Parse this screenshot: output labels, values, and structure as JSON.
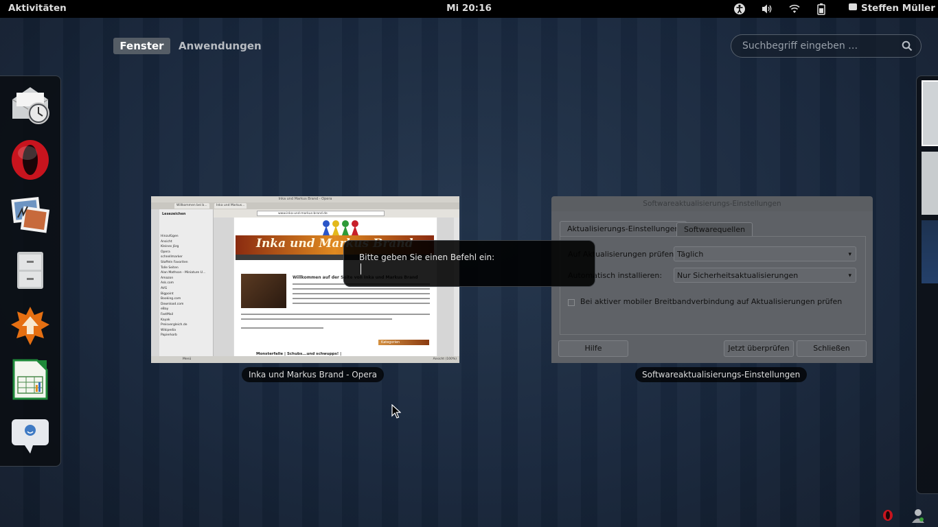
{
  "panel": {
    "activities": "Aktivitäten",
    "clock": "Mi 20:16",
    "user": "Steffen Müller",
    "icons": [
      "accessibility-icon",
      "volume-icon",
      "wifi-icon",
      "battery-icon",
      "chat-icon"
    ]
  },
  "view_selector": {
    "windows": "Fenster",
    "applications": "Anwendungen"
  },
  "search": {
    "placeholder": "Suchbegriff eingeben …"
  },
  "dash": {
    "items": [
      "evolution-mail-icon",
      "opera-icon",
      "shotwell-icon",
      "file-cabinet-icon",
      "update-manager-icon",
      "libreoffice-calc-icon",
      "empathy-chat-icon"
    ]
  },
  "windows": {
    "opera": {
      "caption": "Inka und Markus Brand - Opera",
      "title": "Inka und Markus Brand - Opera",
      "tab1": "Willkommen bei b...",
      "tab2": "Inka und Markus...",
      "address": "www.inka-und-markus-brand.de",
      "sidebar_title": "Lesezeichen",
      "bookmarks": [
        "Hinzufügen",
        "Ansicht",
        "Kleines Jörg",
        "Opera",
        "schnellmarker",
        "Staffeln Favoriten",
        "Tolle Seiten",
        "Alan Mathson - Miniature U...",
        "Amazon",
        "Ask.com",
        "AVG",
        "Bigpoint",
        "Booking.com",
        "Download.com",
        "eBay",
        "FastMail",
        "Kayak",
        "Preisvergleich.de",
        "Wikipedia",
        "Papierkorb"
      ],
      "banner": "Inka und Markus Brand",
      "welcome": "Willkommen auf der Seite von Inka und Markus Brand",
      "categories": "Kategorien",
      "article": "Monsterfalle | Schubs...und schwupps! |",
      "status": "Menü",
      "zoom": "Ansicht (100%)"
    },
    "software": {
      "caption": "Softwareaktualisierungs-Einstellungen",
      "title": "Softwareaktualisierungs-Einstellungen",
      "tab_updates": "Aktualisierungs-Einstellungen",
      "tab_sources": "Softwarequellen",
      "check_label": "Auf Aktualisierungen prüfen:",
      "check_value": "Täglich",
      "install_label": "Automatisch installieren:",
      "install_value": "Nur Sicherheitsaktualisierungen",
      "mobile_label": "Bei aktiver mobiler Breitbandverbindung auf Aktualisierungen prüfen",
      "help": "Hilfe",
      "check_now": "Jetzt überprüfen",
      "close": "Schließen"
    }
  },
  "run_dialog": {
    "prompt": "Bitte geben Sie einen Befehl ein:",
    "value": ""
  },
  "colors": {
    "panel": "#000000",
    "background": "#1a2636",
    "accent_tab": "#555d66"
  }
}
